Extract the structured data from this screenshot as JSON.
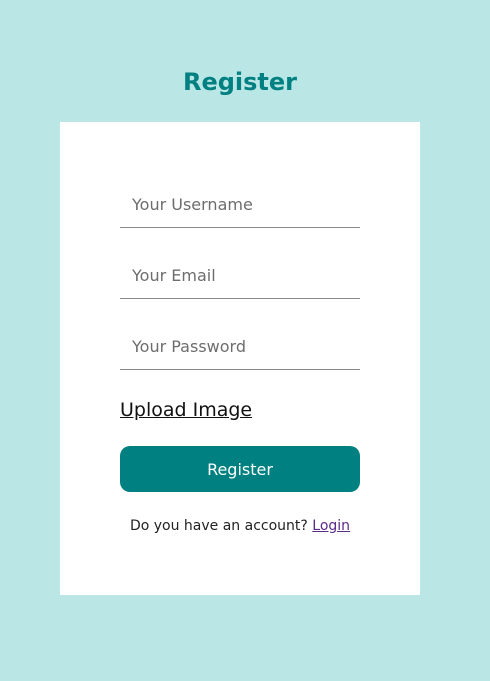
{
  "page": {
    "title": "Register"
  },
  "form": {
    "username_placeholder": "Your Username",
    "username_value": "",
    "email_placeholder": "Your Email",
    "email_value": "",
    "password_placeholder": "Your Password",
    "password_value": "",
    "upload_label": "Upload Image",
    "submit_label": "Register"
  },
  "footer": {
    "prompt_text": "Do you have an account?",
    "login_label": "Login"
  },
  "colors": {
    "background": "#bae6e6",
    "accent": "#008080",
    "card": "#ffffff",
    "link_visited": "#5b2b8a"
  }
}
